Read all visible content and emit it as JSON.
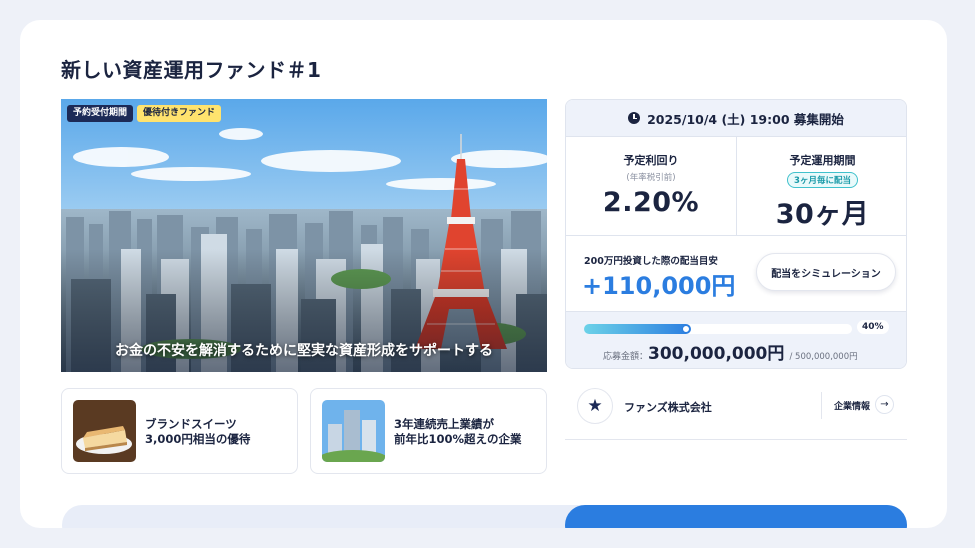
{
  "page": {
    "title": "新しい資産運用ファンド＃1"
  },
  "hero": {
    "badges": [
      "予約受付期間",
      "優待付きファンド"
    ],
    "caption": "お金の不安を解消するために堅実な資産形成をサポートする"
  },
  "features": [
    {
      "line1": "ブランドスイーツ",
      "line2": "3,000円相当の優待",
      "icon": "cheesecake-image"
    },
    {
      "line1": "3年連続売上業績が",
      "line2": "前年比100%超えの企業",
      "icon": "buildings-image"
    }
  ],
  "panel": {
    "start_text": "2025/10/4 (土) 19:00 募集開始",
    "yield_label": "予定利回り",
    "yield_sub": "(年率税引前)",
    "yield_value": "2.20%",
    "period_label": "予定運用期間",
    "period_chip": "3ヶ月毎に配当",
    "period_value": "30ヶ月",
    "sim_label": "200万円投資した際の配当目安",
    "sim_value": "+110,000円",
    "sim_button": "配当をシミュレーション",
    "progress_percent": 40,
    "progress_label": "40%",
    "raise_label": "応募金額：",
    "raise_value": "300,000,000円",
    "raise_total": "/ 500,000,000円"
  },
  "company": {
    "name": "ファンズ株式会社",
    "link_label": "企業情報",
    "arrow": "→",
    "logo_icon": "★"
  },
  "colors": {
    "accent": "#2b7de0",
    "navy": "#1c2a57",
    "yellow": "#ffe36e"
  }
}
